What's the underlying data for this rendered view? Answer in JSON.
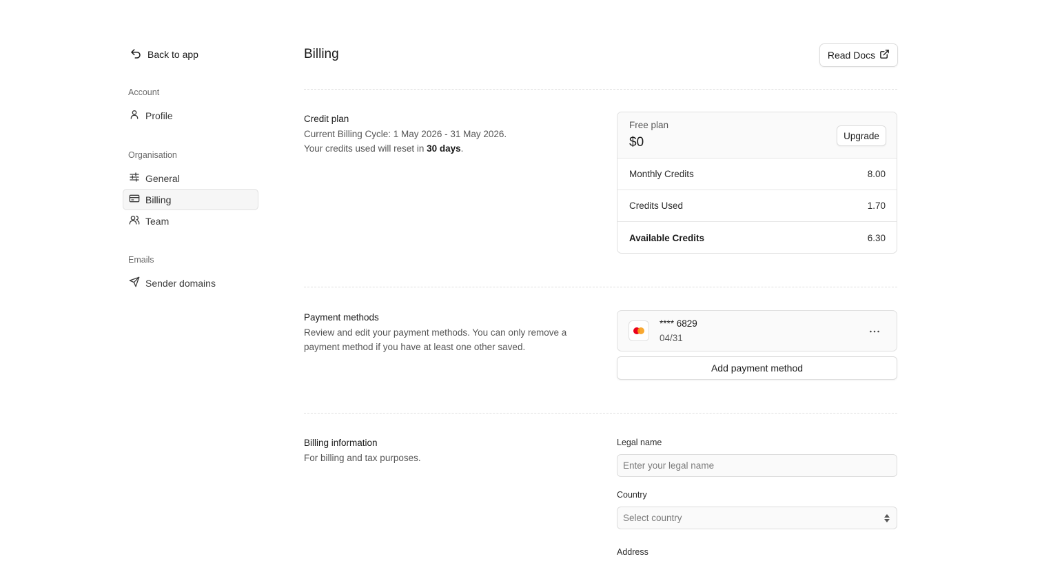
{
  "sidebar": {
    "back_label": "Back to app",
    "sections": [
      {
        "label": "Account",
        "items": [
          {
            "label": "Profile",
            "icon": "user-icon"
          }
        ]
      },
      {
        "label": "Organisation",
        "items": [
          {
            "label": "General",
            "icon": "sliders-icon"
          },
          {
            "label": "Billing",
            "icon": "credit-card-icon",
            "active": true
          },
          {
            "label": "Team",
            "icon": "users-icon"
          }
        ]
      },
      {
        "label": "Emails",
        "items": [
          {
            "label": "Sender domains",
            "icon": "send-icon"
          }
        ]
      }
    ]
  },
  "header": {
    "title": "Billing",
    "docs_button": "Read Docs"
  },
  "credit_plan": {
    "title": "Credit plan",
    "cycle_text": "Current Billing Cycle: 1 May 2026 - 31 May 2026.",
    "reset_prefix": "Your credits used will reset in ",
    "reset_value": "30 days",
    "reset_suffix": ".",
    "plan_name": "Free plan",
    "plan_price": "$0",
    "upgrade_button": "Upgrade",
    "rows": [
      {
        "label": "Monthly Credits",
        "value": "8.00"
      },
      {
        "label": "Credits Used",
        "value": "1.70"
      },
      {
        "label": "Available Credits",
        "value": "6.30"
      }
    ]
  },
  "payment_methods": {
    "title": "Payment methods",
    "description": "Review and edit your payment methods. You can only remove a payment method if you have at least one other saved.",
    "card": {
      "number": "**** 6829",
      "expiry": "04/31",
      "brand_icon": "mastercard-icon",
      "more_icon": "ellipsis-icon"
    },
    "add_button": "Add payment method"
  },
  "billing_info": {
    "title": "Billing information",
    "description": "For billing and tax purposes.",
    "legal_name_label": "Legal name",
    "legal_name_value": "",
    "legal_name_placeholder": "Enter your legal name",
    "country_label": "Country",
    "country_placeholder": "Select country",
    "address_label": "Address"
  },
  "colors": {
    "active_nav_bg": "#f6f6f6",
    "border": "#e0e0e0",
    "mastercard_red": "#eb001b",
    "mastercard_orange": "#f79e1b"
  }
}
